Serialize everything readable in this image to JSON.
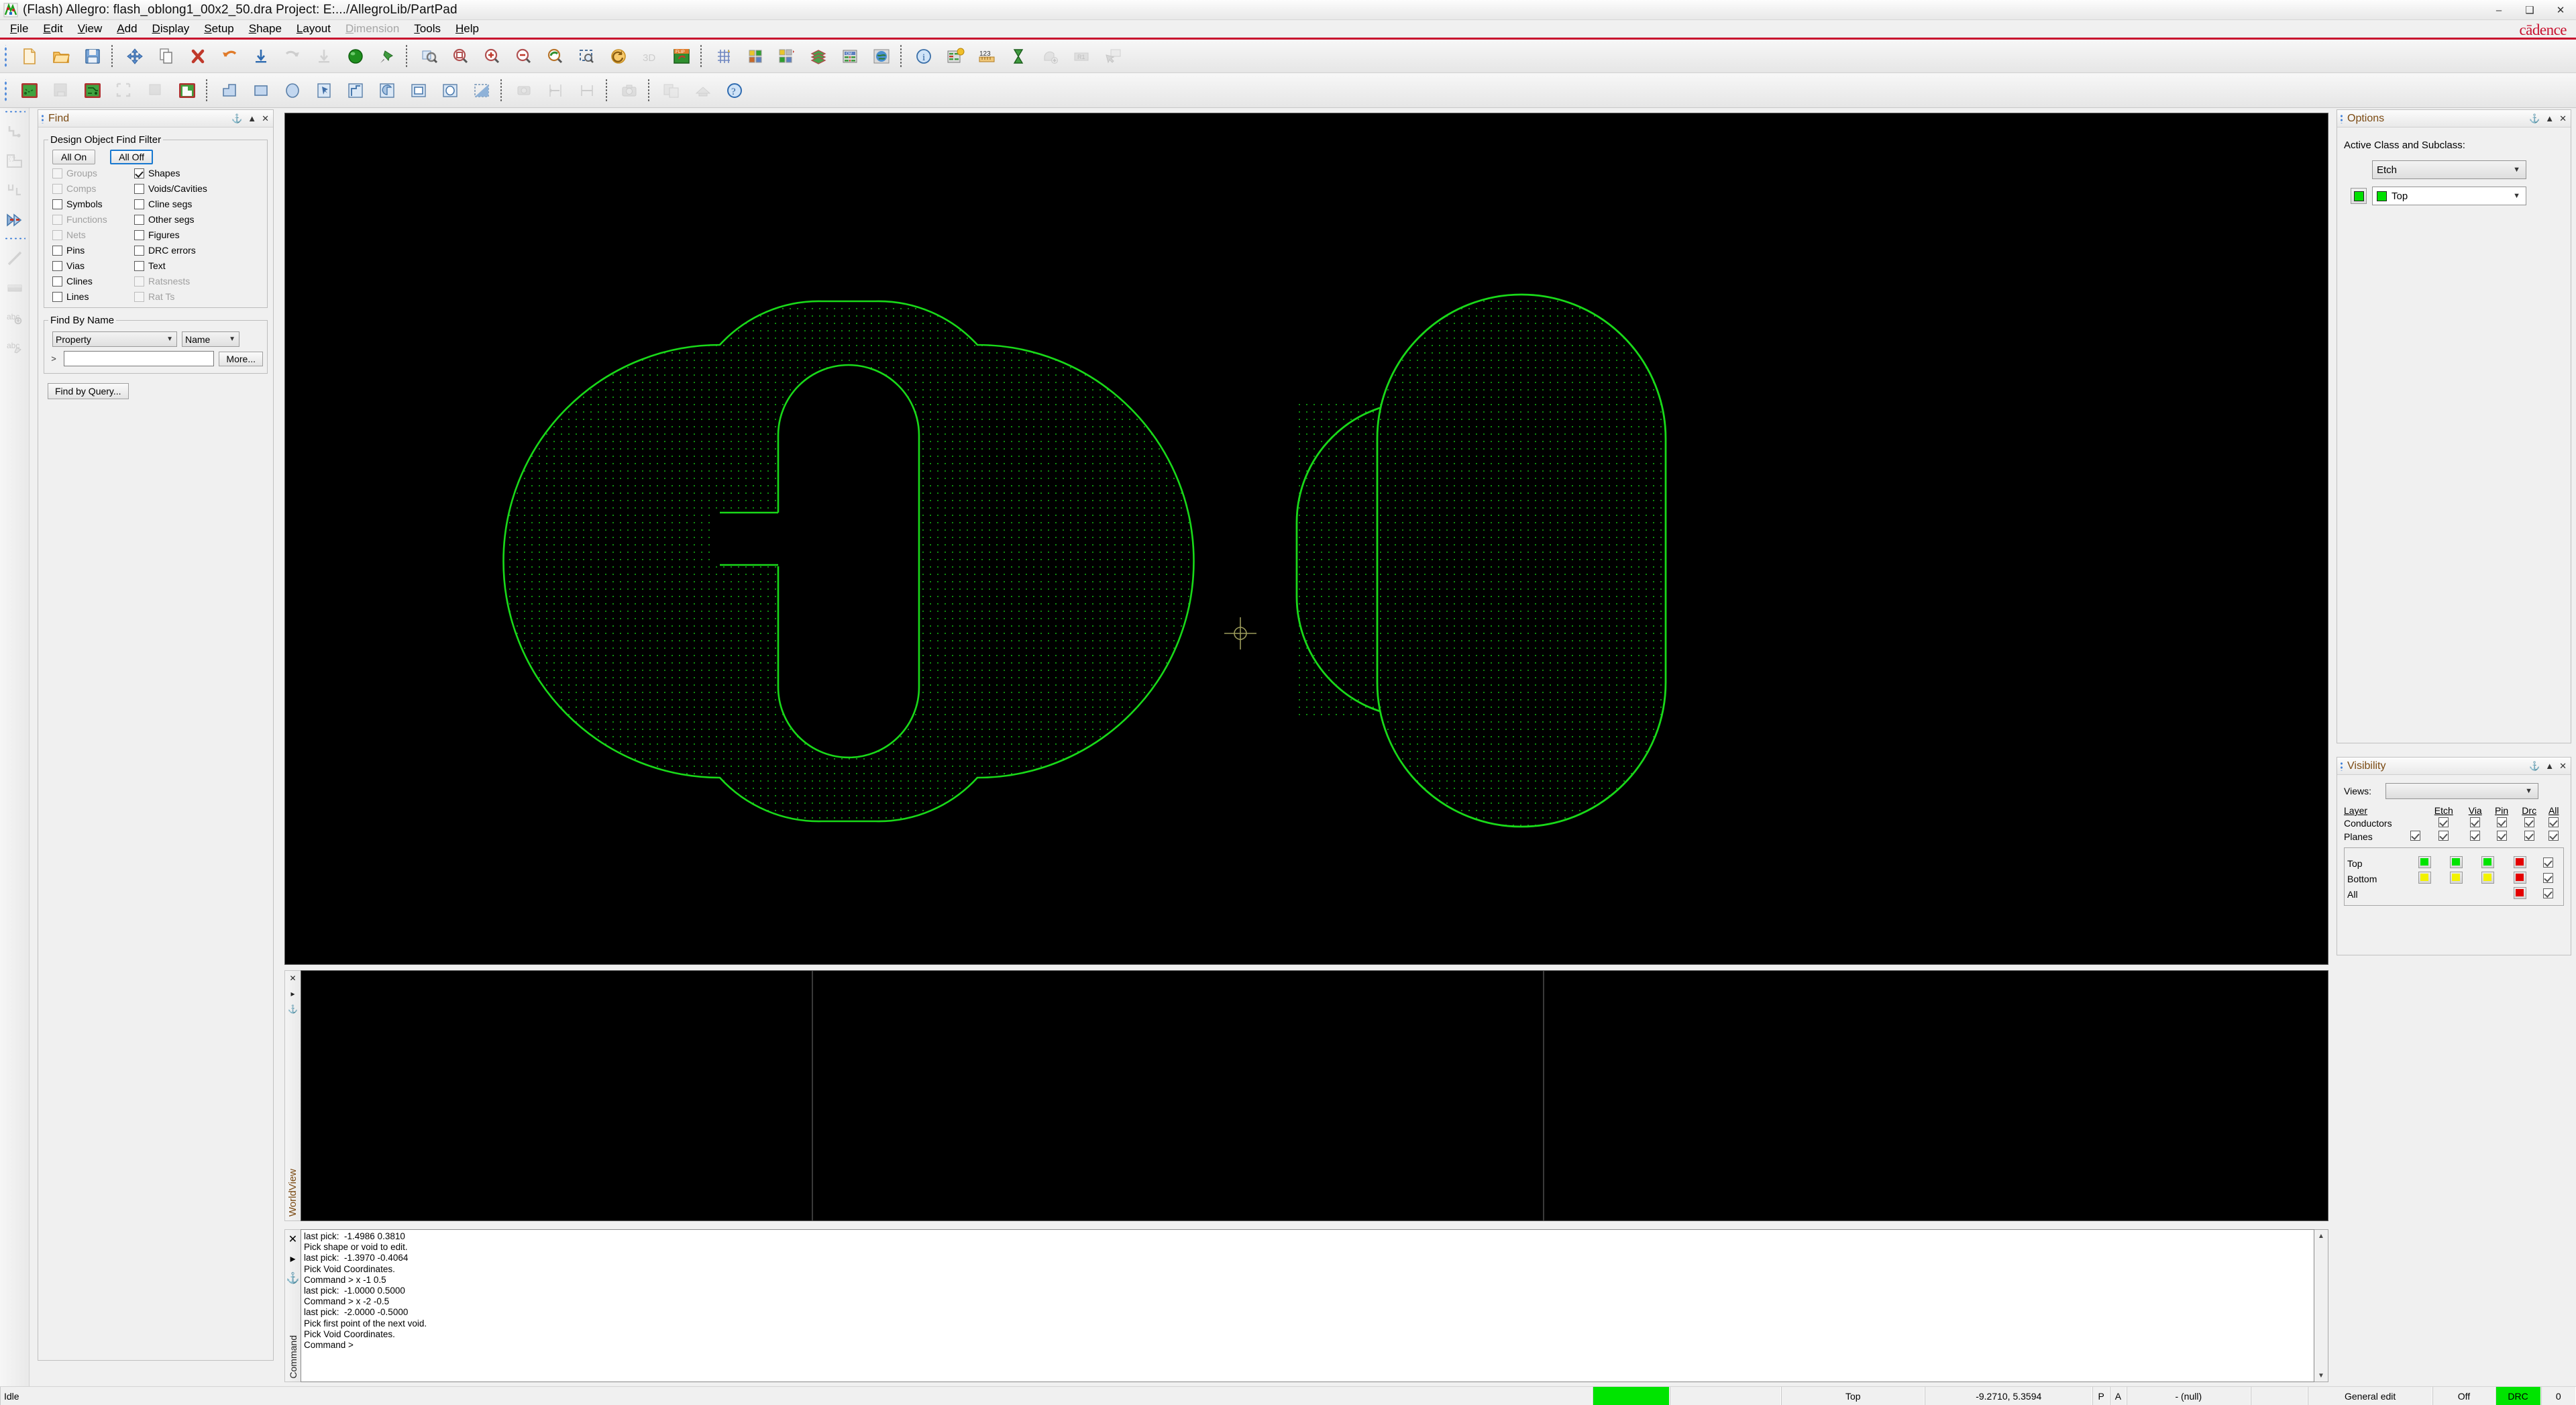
{
  "window": {
    "title": "(Flash) Allegro: flash_oblong1_00x2_50.dra  Project: E:.../AllegroLib/PartPad",
    "app_icon": "allegro-icon",
    "minimize": "–",
    "maximize": "❑",
    "close": "✕",
    "brand": "cādence"
  },
  "menu": {
    "items": [
      {
        "label": "File",
        "mnemonic": "F",
        "disabled": false
      },
      {
        "label": "Edit",
        "mnemonic": "E",
        "disabled": false
      },
      {
        "label": "View",
        "mnemonic": "V",
        "disabled": false
      },
      {
        "label": "Add",
        "mnemonic": "A",
        "disabled": false
      },
      {
        "label": "Display",
        "mnemonic": "D",
        "disabled": false
      },
      {
        "label": "Setup",
        "mnemonic": "S",
        "disabled": false
      },
      {
        "label": "Shape",
        "mnemonic": "S",
        "disabled": false
      },
      {
        "label": "Layout",
        "mnemonic": "L",
        "disabled": false
      },
      {
        "label": "Dimension",
        "mnemonic": "D",
        "disabled": true
      },
      {
        "label": "Tools",
        "mnemonic": "T",
        "disabled": false
      },
      {
        "label": "Help",
        "mnemonic": "H",
        "disabled": false
      }
    ]
  },
  "toolbar_row1": [
    {
      "icon": "new-file-icon",
      "disabled": false
    },
    {
      "icon": "open-folder-icon",
      "disabled": false
    },
    {
      "icon": "save-disk-icon",
      "disabled": false
    },
    {
      "icon": "move-icon",
      "disabled": false
    },
    {
      "icon": "copy-icon",
      "disabled": false
    },
    {
      "icon": "delete-x-icon",
      "disabled": false
    },
    {
      "icon": "undo-icon",
      "disabled": false
    },
    {
      "icon": "import-down-icon",
      "disabled": false
    },
    {
      "icon": "redo-icon",
      "disabled": true
    },
    {
      "icon": "export-down-icon",
      "disabled": true
    },
    {
      "icon": "green-ball-icon",
      "disabled": false
    },
    {
      "icon": "pin-push-icon",
      "disabled": false
    },
    {
      "icon": "zoom-fit-icon",
      "disabled": false
    },
    {
      "icon": "zoom-window-icon",
      "disabled": false
    },
    {
      "icon": "zoom-in-icon",
      "disabled": false
    },
    {
      "icon": "zoom-out-icon",
      "disabled": false
    },
    {
      "icon": "zoom-previous-icon",
      "disabled": false
    },
    {
      "icon": "zoom-selection-icon",
      "disabled": false
    },
    {
      "icon": "refresh-circle-icon",
      "disabled": false
    },
    {
      "icon": "3d-view-icon",
      "disabled": true
    },
    {
      "icon": "flip-design-icon",
      "disabled": false
    },
    {
      "icon": "grid-toggle-icon",
      "disabled": false
    },
    {
      "icon": "color-palette-icon",
      "disabled": false
    },
    {
      "icon": "color-layers-icon",
      "disabled": false
    },
    {
      "icon": "subclass-stack-icon",
      "disabled": false
    },
    {
      "icon": "constraint-manager-icon",
      "disabled": false
    },
    {
      "icon": "globe-grid-icon",
      "disabled": false
    },
    {
      "icon": "info-icon",
      "disabled": false
    },
    {
      "icon": "property-table-icon",
      "disabled": false
    },
    {
      "icon": "measure-123-icon",
      "disabled": false
    },
    {
      "icon": "hourglass-icon",
      "disabled": false
    },
    {
      "icon": "add-shape-icon",
      "disabled": true
    },
    {
      "icon": "r1-label-icon",
      "disabled": true
    },
    {
      "icon": "screen-select-icon",
      "disabled": true
    }
  ],
  "toolbar_row2": [
    {
      "icon": "board-outline-icon",
      "disabled": false
    },
    {
      "icon": "package-keepin-icon",
      "disabled": true
    },
    {
      "icon": "route-keepin-icon",
      "disabled": false
    },
    {
      "icon": "package-keepout-icon",
      "disabled": true
    },
    {
      "icon": "route-keepout-icon",
      "disabled": true
    },
    {
      "icon": "shape-fill-icon",
      "disabled": false
    },
    {
      "icon": "polygon-shape-icon",
      "disabled": false
    },
    {
      "icon": "rectangle-shape-icon",
      "disabled": false
    },
    {
      "icon": "circle-shape-icon",
      "disabled": false
    },
    {
      "icon": "select-shape-icon",
      "disabled": false
    },
    {
      "icon": "shape-boundary-icon",
      "disabled": false
    },
    {
      "icon": "shape-void-icon",
      "disabled": false
    },
    {
      "icon": "square-void-icon",
      "disabled": false
    },
    {
      "icon": "circle-void-icon",
      "disabled": false
    },
    {
      "icon": "gradient-void-icon",
      "disabled": false
    },
    {
      "icon": "camera-plot-icon",
      "disabled": true
    },
    {
      "icon": "dimension-linear-icon",
      "disabled": true
    },
    {
      "icon": "dimension-width-icon",
      "disabled": true
    },
    {
      "icon": "snapshot-camera-icon",
      "disabled": true
    },
    {
      "icon": "copy-layers-icon",
      "disabled": true
    },
    {
      "icon": "report-icon",
      "disabled": true
    },
    {
      "icon": "help-question-icon",
      "disabled": false
    }
  ],
  "left_toolbar": [
    {
      "icon": "route-manual-icon",
      "disabled": true
    },
    {
      "icon": "place-component-icon",
      "disabled": true
    },
    {
      "icon": "slide-segment-icon",
      "disabled": true
    },
    {
      "icon": "delay-tune-icon",
      "disabled": false
    },
    {
      "icon": "add-line-icon",
      "disabled": true
    },
    {
      "icon": "add-rect-icon",
      "disabled": true
    },
    {
      "icon": "add-text-icon",
      "disabled": true
    },
    {
      "icon": "edit-text-icon",
      "disabled": true
    }
  ],
  "find_panel": {
    "title": "Find",
    "tools": {
      "pin": "⚓",
      "collapse": "▲",
      "close": "✕"
    },
    "filter_group_label": "Design Object Find Filter",
    "all_on_label": "All On",
    "all_off_label": "All Off",
    "checkboxes": [
      {
        "label": "Groups",
        "checked": false,
        "disabled": true
      },
      {
        "label": "Shapes",
        "checked": true,
        "disabled": false
      },
      {
        "label": "Comps",
        "checked": false,
        "disabled": true
      },
      {
        "label": "Voids/Cavities",
        "checked": false,
        "disabled": false
      },
      {
        "label": "Symbols",
        "checked": false,
        "disabled": false
      },
      {
        "label": "Cline segs",
        "checked": false,
        "disabled": false
      },
      {
        "label": "Functions",
        "checked": false,
        "disabled": true
      },
      {
        "label": "Other segs",
        "checked": false,
        "disabled": false
      },
      {
        "label": "Nets",
        "checked": false,
        "disabled": true
      },
      {
        "label": "Figures",
        "checked": false,
        "disabled": false
      },
      {
        "label": "Pins",
        "checked": false,
        "disabled": false
      },
      {
        "label": "DRC errors",
        "checked": false,
        "disabled": false
      },
      {
        "label": "Vias",
        "checked": false,
        "disabled": false
      },
      {
        "label": "Text",
        "checked": false,
        "disabled": false
      },
      {
        "label": "Clines",
        "checked": false,
        "disabled": false
      },
      {
        "label": "Ratsnests",
        "checked": false,
        "disabled": true
      },
      {
        "label": "Lines",
        "checked": false,
        "disabled": false
      },
      {
        "label": "Rat Ts",
        "checked": false,
        "disabled": true
      }
    ],
    "find_by_name_label": "Find By Name",
    "object_type": "Property",
    "name_mode": "Name",
    "name_value": "",
    "name_prompt": ">",
    "more_label": "More...",
    "find_by_query_label": "Find by Query..."
  },
  "options_panel": {
    "title": "Options",
    "tools": {
      "pin": "⚓",
      "collapse": "▲",
      "close": "✕"
    },
    "active_class_label": "Active Class and Subclass:",
    "class_value": "Etch",
    "subclass_value": "Top",
    "subclass_color": "#00e000"
  },
  "visibility_panel": {
    "title": "Visibility",
    "tools": {
      "pin": "⚓",
      "collapse": "▲",
      "close": "✕"
    },
    "views_label": "Views:",
    "views_value": "",
    "columns": [
      "Layer",
      "Etch",
      "Via",
      "Pin",
      "Drc",
      "All"
    ],
    "rows": [
      {
        "name": "Conductors",
        "lead": null,
        "cells": [
          "check",
          "check",
          "check",
          "check",
          "check"
        ]
      },
      {
        "name": "Planes",
        "lead": "check",
        "cells": [
          "check",
          "check",
          "check",
          "check",
          "check"
        ]
      }
    ],
    "layers": [
      {
        "name": "Top",
        "colors": [
          "#00e400",
          "#00e400",
          "#00e400",
          "#e40000"
        ],
        "all": "check"
      },
      {
        "name": "Bottom",
        "colors": [
          "#f2f200",
          "#f2f200",
          "#f2f200",
          "#e40000"
        ],
        "all": "check"
      },
      {
        "name": "All",
        "colors": [
          null,
          null,
          null,
          "#e40000"
        ],
        "all": "check"
      }
    ]
  },
  "worldview": {
    "title": "WorldView",
    "tools": {
      "close": "✕",
      "expand": "▸",
      "pin": "⚓"
    }
  },
  "console": {
    "label": "Command",
    "tools": {
      "close": "✕",
      "expand": "▸",
      "pin": "⚓"
    },
    "lines": [
      "last pick:  -1.4986 0.3810",
      "Pick shape or void to edit.",
      "last pick:  -1.3970 -0.4064",
      "Pick Void Coordinates.",
      "Command > x -1 0.5",
      "last pick:  -1.0000 0.5000",
      "Command > x -2 -0.5",
      "last pick:  -2.0000 -0.5000",
      "Pick first point of the next void.",
      "Pick Void Coordinates.",
      "Command >"
    ]
  },
  "statusbar": {
    "state": "Idle",
    "indicator_color": "#00e400",
    "blank1": "",
    "layer": "Top",
    "coordinates": "-9.2710, 5.3594",
    "p_flag": "P",
    "a_flag": "A",
    "net": "- (null)",
    "blank2": "",
    "mode": "General edit",
    "grid": "Off",
    "drc_label": "DRC",
    "drc_count": "0"
  },
  "canvas": {
    "background": "#000000",
    "shape_color": "#19d919",
    "hatch_color": "#0e7a0e",
    "cursor_color": "#9a9a5a",
    "left_shape": "oblong-pad-with-void-and-gap",
    "right_shape": "oblong-pad-solid"
  }
}
